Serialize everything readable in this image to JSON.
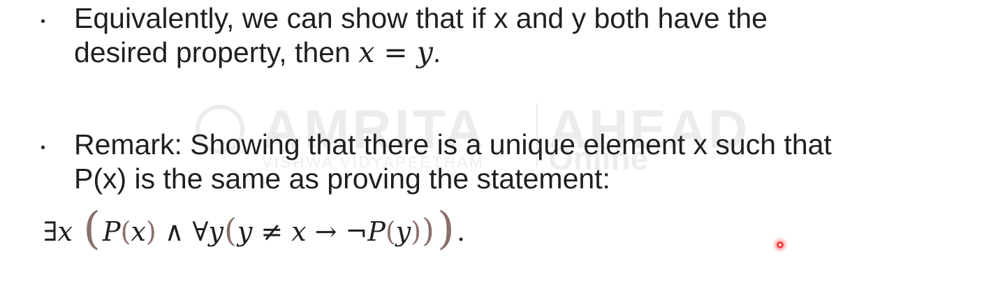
{
  "watermark": {
    "brand": "AMRITA",
    "subtitle": "VISHWA VIDYAPEETHAM",
    "right_top": "AHEAD",
    "right_bottom": "Online"
  },
  "bullets": [
    {
      "line1": "Equivalently, we can show that if x and y both have the",
      "line2_prefix": "desired property, then ",
      "line2_math_x": "x",
      "line2_math_eq": " = ",
      "line2_math_y": "y",
      "line2_suffix": "."
    },
    {
      "line1": "Remark: Showing that there is a unique element x such that",
      "line2": "P(x) is the same as proving the statement:"
    }
  ],
  "bullet_marker": "•",
  "formula": {
    "exists": "∃",
    "x1": "x",
    "open_big": "(",
    "P1": "P",
    "open_small1": "(",
    "x2": "x",
    "close_small1": ")",
    "and": "∧",
    "forall": "∀",
    "y1": "y",
    "open_mid": "(",
    "y2": "y",
    "neq": "≠",
    "x3": "x",
    "arrow": "→",
    "neg": "¬",
    "P2": "P",
    "open_small2": "(",
    "y3": "y",
    "close_small2": ")",
    "close_mid": ")",
    "close_big": ")",
    "end": "."
  },
  "colors": {
    "text": "#1f1f1f",
    "paren": "#8a6f6a",
    "laser": "#ff3b3b"
  }
}
